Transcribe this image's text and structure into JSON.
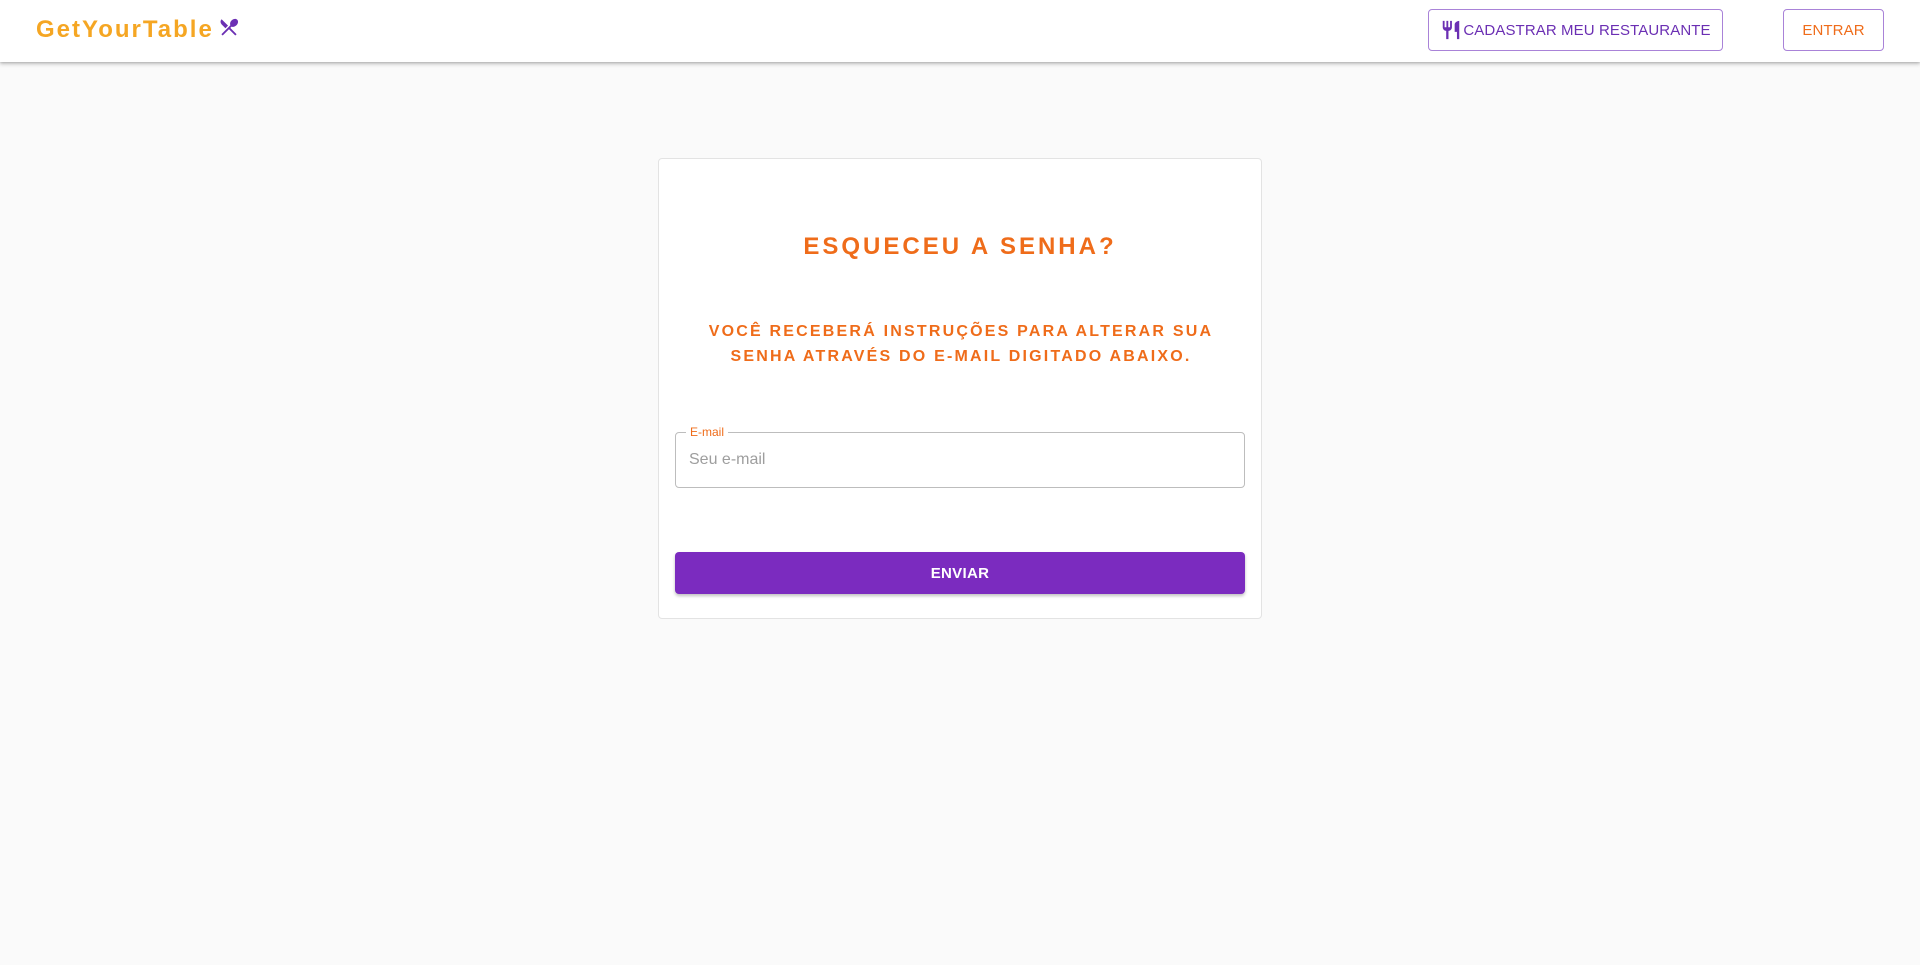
{
  "header": {
    "brand": "GetYourTable",
    "brand_icon": "utensils-crossed-icon",
    "register_button": {
      "label": "CADASTRAR MEU RESTAURANTE",
      "icon": "fork-knife-icon"
    },
    "login_button": {
      "label": "ENTRAR"
    }
  },
  "form": {
    "title": "ESQUECEU A SENHA?",
    "subtitle": "VOCÊ RECEBERÁ INSTRUÇÕES PARA ALTERAR SUA SENHA ATRAVÉS DO E-MAIL DIGITADO ABAIXO.",
    "email_label": "E-mail",
    "email_placeholder": "Seu e-mail",
    "email_value": "",
    "submit_label": "ENVIAR"
  },
  "colors": {
    "brand": "#f5a623",
    "accent_orange": "#ef6c1a",
    "primary_purple": "#7b2bbf"
  }
}
